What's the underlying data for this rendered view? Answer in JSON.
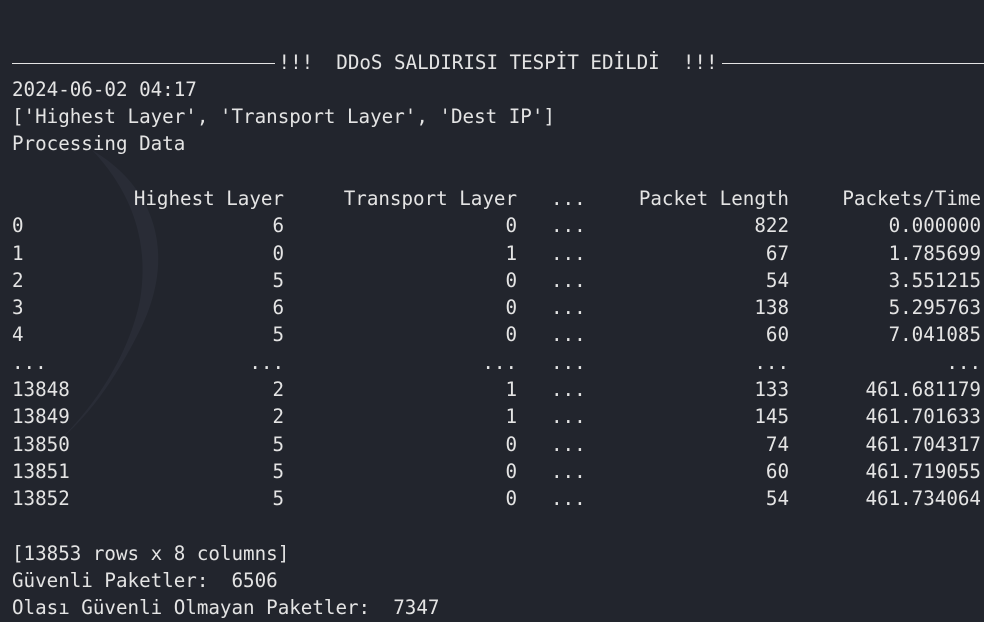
{
  "terminal": {
    "banner_prefix": "!!!",
    "banner_text": "DDoS SALDIRISI TESPİT EDİLDİ",
    "banner_suffix": "!!!",
    "timestamp": "2024-06-02 04:17",
    "columns_list": "['Highest Layer', 'Transport Layer', 'Dest IP']",
    "processing": "Processing Data",
    "table": {
      "headers": [
        "",
        "Highest Layer",
        "Transport Layer",
        "...",
        "Packet Length",
        "Packets/Time"
      ],
      "rows": [
        [
          "0",
          "6",
          "0",
          "...",
          "822",
          "0.000000"
        ],
        [
          "1",
          "0",
          "1",
          "...",
          "67",
          "1.785699"
        ],
        [
          "2",
          "5",
          "0",
          "...",
          "54",
          "3.551215"
        ],
        [
          "3",
          "6",
          "0",
          "...",
          "138",
          "5.295763"
        ],
        [
          "4",
          "5",
          "0",
          "...",
          "60",
          "7.041085"
        ],
        [
          "...",
          "...",
          "...",
          "...",
          "...",
          "..."
        ],
        [
          "13848",
          "2",
          "1",
          "...",
          "133",
          "461.681179"
        ],
        [
          "13849",
          "2",
          "1",
          "...",
          "145",
          "461.701633"
        ],
        [
          "13850",
          "5",
          "0",
          "...",
          "74",
          "461.704317"
        ],
        [
          "13851",
          "5",
          "0",
          "...",
          "60",
          "461.719055"
        ],
        [
          "13852",
          "5",
          "0",
          "...",
          "54",
          "461.734064"
        ]
      ]
    },
    "shape": "[13853 rows x 8 columns]",
    "safe_label": "Güvenli Paketler:  6506",
    "unsafe_label": "Olası Güvenli Olmayan Paketler:  7347"
  },
  "colors": {
    "background": "#22252d",
    "foreground": "#e4e4e4"
  }
}
